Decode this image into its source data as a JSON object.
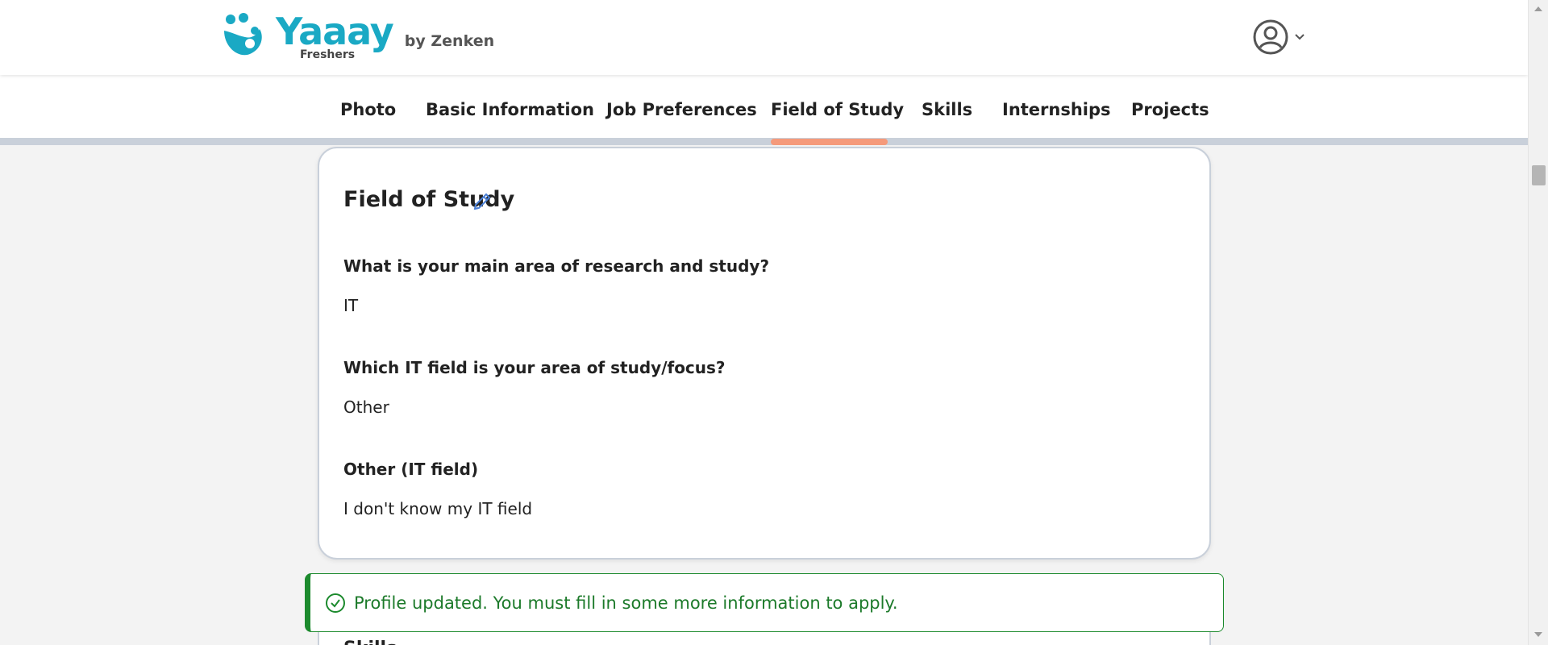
{
  "header": {
    "logo_name": "Yaaay",
    "logo_sub": "Freshers",
    "logo_by": "by Zenken",
    "brand_color": "#1aa9c4",
    "user_icon": "user-circle-icon",
    "dropdown_icon": "chevron-down-icon"
  },
  "tabs": [
    {
      "label": "Photo"
    },
    {
      "label": "Basic Information"
    },
    {
      "label": "Job Preferences"
    },
    {
      "label": "Field of Study",
      "active": true
    },
    {
      "label": "Skills"
    },
    {
      "label": "Internships"
    },
    {
      "label": "Projects"
    }
  ],
  "active_tab_color": "#f59a7b",
  "card": {
    "title": "Field of Study",
    "edit_icon": "pencil-icon",
    "fields": [
      {
        "question": "What is your main area of research and study?",
        "answer": "IT"
      },
      {
        "question": "Which IT field is your area of study/focus?",
        "answer": "Other"
      },
      {
        "question": "Other (IT field)",
        "answer": "I don't know my IT field"
      }
    ]
  },
  "next_card": {
    "title": "Skills"
  },
  "toast": {
    "icon": "check-circle-icon",
    "message": "Profile updated. You must fill in some more information to apply.",
    "color": "#1c8a2d"
  }
}
